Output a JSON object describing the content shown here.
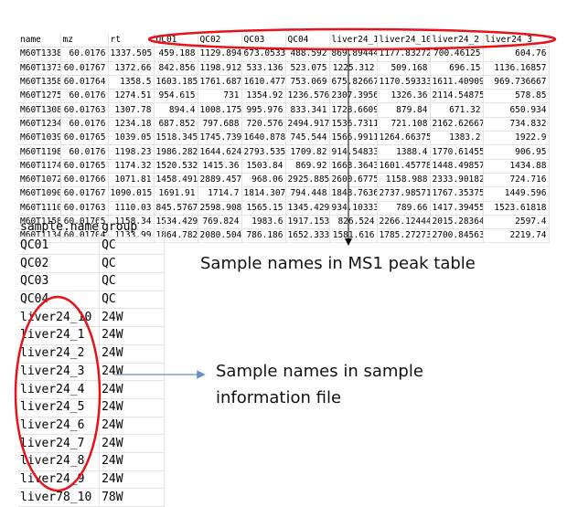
{
  "peak_table": {
    "headers": [
      "name",
      "mz",
      "rt",
      "QC01",
      "QC02",
      "QC03",
      "QC04",
      "liver24_1",
      "liver24_10",
      "liver24_2",
      "liver24_3"
    ],
    "rows": [
      [
        "M60T1338",
        "60.0176",
        "1337.505",
        "459.188",
        "1129.894",
        "673.0533",
        "488.592",
        "869.89444",
        "1177.83272",
        "700.46125",
        "604.76"
      ],
      [
        "M60T1373",
        "60.01767",
        "1372.66",
        "842.856",
        "1198.912",
        "533.136",
        "523.075",
        "1225.312",
        "509.168",
        "696.15",
        "1136.16857"
      ],
      [
        "M60T1358",
        "60.01764",
        "1358.5",
        "1603.185",
        "1761.687",
        "1610.477",
        "753.069",
        "675.82667",
        "1170.59333",
        "1611.40909",
        "969.736667"
      ],
      [
        "M60T1275",
        "60.0176",
        "1274.51",
        "954.615",
        "731",
        "1354.92",
        "1236.576",
        "2307.3956",
        "1326.36",
        "2114.54875",
        "578.85"
      ],
      [
        "M60T1308",
        "60.01763",
        "1307.78",
        "894.4",
        "1008.175",
        "995.976",
        "833.341",
        "1728.6609",
        "879.84",
        "671.32",
        "650.934"
      ],
      [
        "M60T1234",
        "60.0176",
        "1234.18",
        "687.852",
        "797.688",
        "720.576",
        "2494.917",
        "1536.7311",
        "721.108",
        "2162.62667",
        "734.832"
      ],
      [
        "M60T1039",
        "60.01765",
        "1039.05",
        "1518.345",
        "1745.739",
        "1640.878",
        "745.544",
        "1566.9911",
        "1264.66375",
        "1383.2",
        "1922.9"
      ],
      [
        "M60T1198",
        "60.0176",
        "1198.23",
        "1986.282",
        "1644.624",
        "2793.535",
        "1709.82",
        "914.54833",
        "1388.4",
        "1770.61455",
        "906.95"
      ],
      [
        "M60T1174",
        "60.01765",
        "1174.32",
        "1520.532",
        "1415.36",
        "1503.84",
        "869.92",
        "1668.3643",
        "1601.45778",
        "1448.49857",
        "1434.88"
      ],
      [
        "M60T1072",
        "60.01766",
        "1071.81",
        "1458.491",
        "2889.457",
        "968.06",
        "2925.885",
        "2600.6775",
        "1158.988",
        "2333.90182",
        "724.716"
      ],
      [
        "M60T1090",
        "60.01767",
        "1090.015",
        "1691.91",
        "1714.7",
        "1814.307",
        "794.448",
        "1848.7636",
        "2737.98571",
        "1767.35375",
        "1449.596"
      ],
      [
        "M60T1110",
        "60.01763",
        "1110.03",
        "845.5767",
        "2598.908",
        "1565.15",
        "1345.429",
        "934.10333",
        "789.66",
        "1417.39455",
        "1523.61818"
      ],
      [
        "M60T1158",
        "60.01765",
        "1158.34",
        "1534.429",
        "769.824",
        "1983.6",
        "1917.153",
        "826.524",
        "2266.12444",
        "2015.28364",
        "2597.4"
      ],
      [
        "M60T1134",
        "60.01704",
        "1133.99",
        "1864.782",
        "2080.504",
        "786.186",
        "1652.333",
        "1581.616",
        "1785.27273",
        "2700.84563",
        "2219.74"
      ]
    ]
  },
  "info_table": {
    "headers": [
      "sample.name",
      "group"
    ],
    "rows": [
      [
        "QC01",
        "QC"
      ],
      [
        "QC02",
        "QC"
      ],
      [
        "QC03",
        "QC"
      ],
      [
        "QC04",
        "QC"
      ],
      [
        "liver24_10",
        "24W"
      ],
      [
        "liver24_1",
        "24W"
      ],
      [
        "liver24_2",
        "24W"
      ],
      [
        "liver24_3",
        "24W"
      ],
      [
        "liver24_4",
        "24W"
      ],
      [
        "liver24_5",
        "24W"
      ],
      [
        "liver24_6",
        "24W"
      ],
      [
        "liver24_7",
        "24W"
      ],
      [
        "liver24_8",
        "24W"
      ],
      [
        "liver24_9",
        "24W"
      ],
      [
        "liver78_10",
        "78W"
      ]
    ]
  },
  "annotations": {
    "peak_label": "Sample names in MS1 peak table",
    "info_label_line1": "Sample names in sample",
    "info_label_line2": "information file"
  },
  "colors": {
    "ellipse": "#e8121b",
    "arrow_black": "#000000",
    "arrow_blue": "#6a8fc8"
  }
}
